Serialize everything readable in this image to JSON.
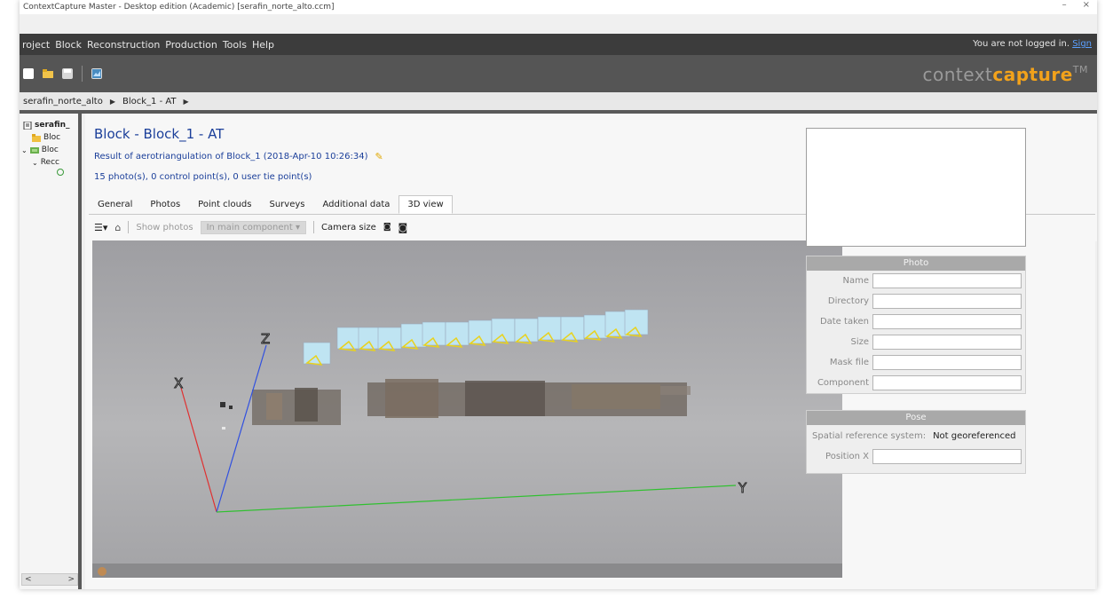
{
  "window": {
    "title": "ContextCapture Master - Desktop edition (Academic) [serafin_norte_alto.ccm]",
    "controls": [
      "–",
      "×"
    ]
  },
  "menubar": {
    "items": [
      "roject",
      "Block",
      "Reconstruction",
      "Production",
      "Tools",
      "Help"
    ],
    "login_text": "You are not logged in.",
    "login_link": "Sign"
  },
  "toolbar": {
    "brand_part1": "context",
    "brand_part2": "capture",
    "brand_tm": "TM"
  },
  "breadcrumb": {
    "items": [
      "serafin_norte_alto",
      "Block_1 - AT"
    ]
  },
  "tree": {
    "items": [
      {
        "label": "serafin_",
        "icon": "project-icon"
      },
      {
        "label": "Bloc",
        "icon": "folder-icon"
      },
      {
        "label": "Bloc",
        "icon": "block-icon"
      },
      {
        "label": "Recc",
        "icon": "reconstruction-icon"
      }
    ],
    "scroll_left": "<",
    "scroll_right": ">"
  },
  "block": {
    "title": "Block - Block_1 - AT",
    "subtitle": "Result of aerotriangulation of Block_1 (2018-Apr-10 10:26:34)",
    "info": "15 photo(s), 0 control point(s), 0 user tie point(s)"
  },
  "tabs": [
    {
      "label": "General",
      "active": false
    },
    {
      "label": "Photos",
      "active": false
    },
    {
      "label": "Point clouds",
      "active": false
    },
    {
      "label": "Surveys",
      "active": false
    },
    {
      "label": "Additional data",
      "active": false
    },
    {
      "label": "3D view",
      "active": true
    }
  ],
  "view_toolbar": {
    "show_photos_label": "Show photos",
    "show_photos_value": "In main component",
    "camera_size_label": "Camera size"
  },
  "viewport": {
    "axis_labels": {
      "x": "X",
      "y": "Y",
      "z": "Z"
    },
    "axis_colors": {
      "x": "#e03030",
      "y": "#30c030",
      "z": "#3050e0"
    }
  },
  "photo_panel": {
    "header": "Photo",
    "fields": [
      "Name",
      "Directory",
      "Date taken",
      "Size",
      "Mask file",
      "Component"
    ]
  },
  "pose_panel": {
    "header": "Pose",
    "srs_label": "Spatial reference system:",
    "srs_value": "Not georeferenced",
    "fields": [
      "Position X"
    ]
  }
}
